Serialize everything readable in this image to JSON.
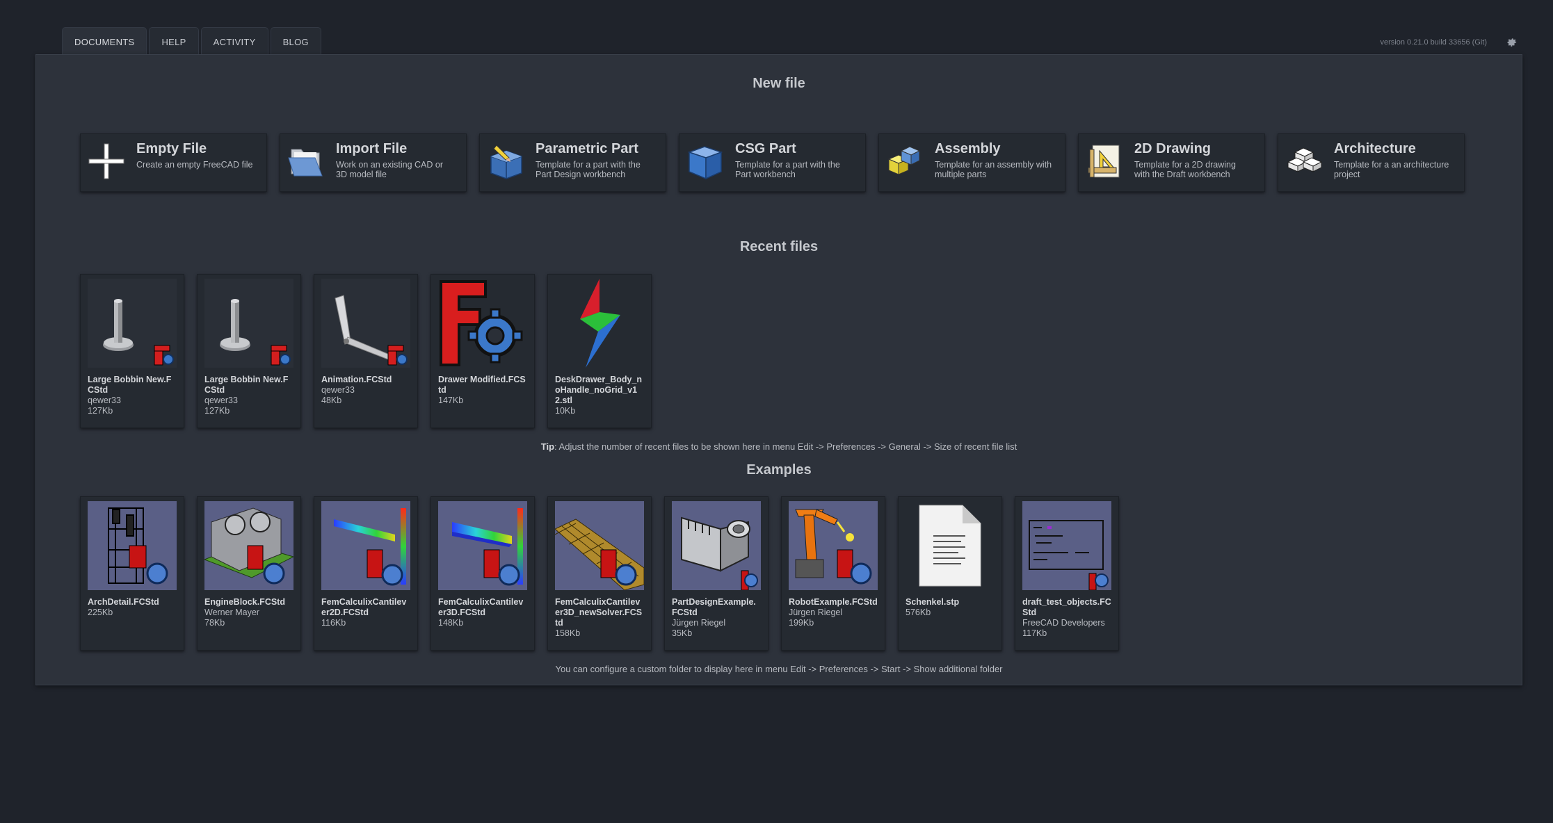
{
  "tabs": [
    {
      "label": "DOCUMENTS",
      "active": true
    },
    {
      "label": "HELP",
      "active": false
    },
    {
      "label": "ACTIVITY",
      "active": false
    },
    {
      "label": "BLOG",
      "active": false
    }
  ],
  "version_text": "version 0.21.0 build 33656 (Git)",
  "new_file": {
    "title": "New file",
    "items": [
      {
        "title": "Empty File",
        "desc": "Create an empty FreeCAD file",
        "icon": "plus-icon"
      },
      {
        "title": "Import File",
        "desc": "Work on an existing CAD or 3D model file",
        "icon": "folder-icon"
      },
      {
        "title": "Parametric Part",
        "desc": "Template for a part with the Part Design workbench",
        "icon": "parametric-part-icon"
      },
      {
        "title": "CSG Part",
        "desc": "Template for a part with the Part workbench",
        "icon": "cube-icon"
      },
      {
        "title": "Assembly",
        "desc": "Template for an assembly with multiple parts",
        "icon": "assembly-icon"
      },
      {
        "title": "2D Drawing",
        "desc": "Template for a 2D drawing with the Draft workbench",
        "icon": "drawing-icon"
      },
      {
        "title": "Architecture",
        "desc": "Template for a an architecture project",
        "icon": "architecture-bricks-icon"
      }
    ]
  },
  "recent": {
    "title": "Recent files",
    "files": [
      {
        "name": "Large Bobbin New.FCStd",
        "author": "qewer33",
        "size": "127Kb",
        "thumb": "bobbin"
      },
      {
        "name": "Large Bobbin New.FCStd",
        "author": "qewer33",
        "size": "127Kb",
        "thumb": "bobbin"
      },
      {
        "name": "Animation.FCStd",
        "author": "qewer33",
        "size": "48Kb",
        "thumb": "arm"
      },
      {
        "name": "Drawer Modified.FCStd",
        "author": "",
        "size": "147Kb",
        "thumb": "freecad-logo"
      },
      {
        "name": "DeskDrawer_Body_noHandle_noGrid_v12.stl",
        "author": "",
        "size": "10Kb",
        "thumb": "bolt"
      }
    ],
    "tip_label": "Tip",
    "tip_text": ": Adjust the number of recent files to be shown here in menu Edit -> Preferences -> General -> Size of recent file list"
  },
  "examples": {
    "title": "Examples",
    "files": [
      {
        "name": "ArchDetail.FCStd",
        "author": "",
        "size": "225Kb",
        "thumb": "arch"
      },
      {
        "name": "EngineBlock.FCStd",
        "author": "Werner Mayer",
        "size": "78Kb",
        "thumb": "engine"
      },
      {
        "name": "FemCalculixCantilever2D.FCStd",
        "author": "",
        "size": "116Kb",
        "thumb": "fem2d"
      },
      {
        "name": "FemCalculixCantilever3D.FCStd",
        "author": "",
        "size": "148Kb",
        "thumb": "fem3d"
      },
      {
        "name": "FemCalculixCantilever3D_newSolver.FCStd",
        "author": "",
        "size": "158Kb",
        "thumb": "femmesh"
      },
      {
        "name": "PartDesignExample.FCStd",
        "author": "Jürgen Riegel",
        "size": "35Kb",
        "thumb": "partdesign"
      },
      {
        "name": "RobotExample.FCStd",
        "author": "Jürgen Riegel",
        "size": "199Kb",
        "thumb": "robot"
      },
      {
        "name": "Schenkel.stp",
        "author": "",
        "size": "576Kb",
        "thumb": "document"
      },
      {
        "name": "draft_test_objects.FCStd",
        "author": "FreeCAD Developers",
        "size": "117Kb",
        "thumb": "draft"
      }
    ],
    "footer_text": "You can configure a custom folder to display here in menu Edit -> Preferences -> Start -> Show additional folder"
  }
}
